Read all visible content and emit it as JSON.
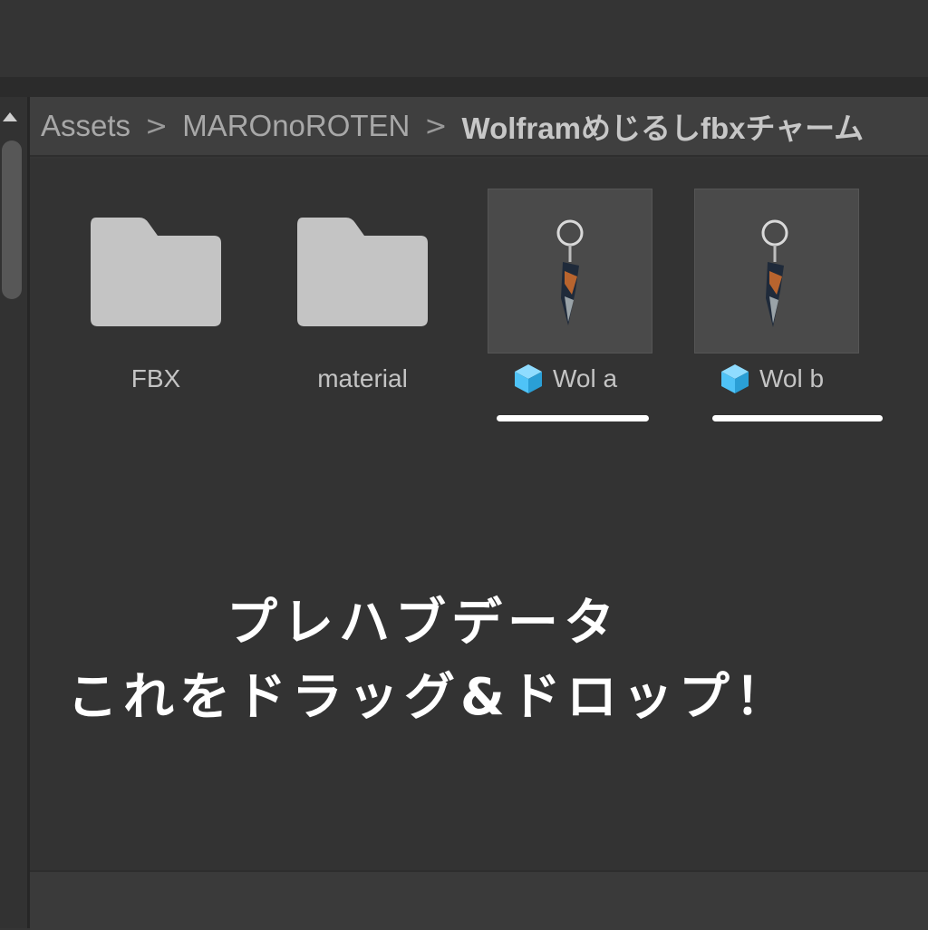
{
  "breadcrumb": {
    "items": [
      "Assets",
      "MAROnoROTEN",
      "Wolframめじるしfbxチャーム"
    ],
    "separator": ">"
  },
  "assets": {
    "folders": [
      {
        "label": "FBX",
        "icon": "folder-icon"
      },
      {
        "label": "material",
        "icon": "folder-icon"
      }
    ],
    "prefabs": [
      {
        "label": "Wol a",
        "icon": "prefab-cube-icon"
      },
      {
        "label": "Wol b",
        "icon": "prefab-cube-icon"
      }
    ]
  },
  "caption": {
    "line1": "プレハブデータ",
    "line2": "これをドラッグ&ドロップ！"
  },
  "colors": {
    "folder": "#c4c4c4",
    "prefab_cube": "#4fc3f7",
    "underline": "#ffffff"
  }
}
